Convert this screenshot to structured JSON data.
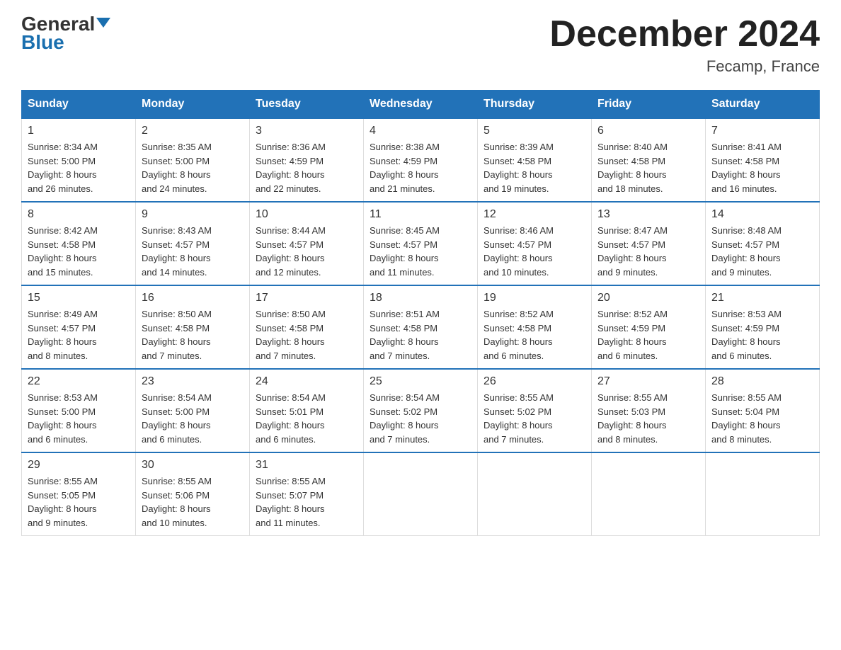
{
  "header": {
    "logo_general": "General",
    "logo_blue": "Blue",
    "month_title": "December 2024",
    "location": "Fecamp, France"
  },
  "days_of_week": [
    "Sunday",
    "Monday",
    "Tuesday",
    "Wednesday",
    "Thursday",
    "Friday",
    "Saturday"
  ],
  "weeks": [
    [
      {
        "day": "1",
        "sunrise": "8:34 AM",
        "sunset": "5:00 PM",
        "daylight": "8 hours and 26 minutes."
      },
      {
        "day": "2",
        "sunrise": "8:35 AM",
        "sunset": "5:00 PM",
        "daylight": "8 hours and 24 minutes."
      },
      {
        "day": "3",
        "sunrise": "8:36 AM",
        "sunset": "4:59 PM",
        "daylight": "8 hours and 22 minutes."
      },
      {
        "day": "4",
        "sunrise": "8:38 AM",
        "sunset": "4:59 PM",
        "daylight": "8 hours and 21 minutes."
      },
      {
        "day": "5",
        "sunrise": "8:39 AM",
        "sunset": "4:58 PM",
        "daylight": "8 hours and 19 minutes."
      },
      {
        "day": "6",
        "sunrise": "8:40 AM",
        "sunset": "4:58 PM",
        "daylight": "8 hours and 18 minutes."
      },
      {
        "day": "7",
        "sunrise": "8:41 AM",
        "sunset": "4:58 PM",
        "daylight": "8 hours and 16 minutes."
      }
    ],
    [
      {
        "day": "8",
        "sunrise": "8:42 AM",
        "sunset": "4:58 PM",
        "daylight": "8 hours and 15 minutes."
      },
      {
        "day": "9",
        "sunrise": "8:43 AM",
        "sunset": "4:57 PM",
        "daylight": "8 hours and 14 minutes."
      },
      {
        "day": "10",
        "sunrise": "8:44 AM",
        "sunset": "4:57 PM",
        "daylight": "8 hours and 12 minutes."
      },
      {
        "day": "11",
        "sunrise": "8:45 AM",
        "sunset": "4:57 PM",
        "daylight": "8 hours and 11 minutes."
      },
      {
        "day": "12",
        "sunrise": "8:46 AM",
        "sunset": "4:57 PM",
        "daylight": "8 hours and 10 minutes."
      },
      {
        "day": "13",
        "sunrise": "8:47 AM",
        "sunset": "4:57 PM",
        "daylight": "8 hours and 9 minutes."
      },
      {
        "day": "14",
        "sunrise": "8:48 AM",
        "sunset": "4:57 PM",
        "daylight": "8 hours and 9 minutes."
      }
    ],
    [
      {
        "day": "15",
        "sunrise": "8:49 AM",
        "sunset": "4:57 PM",
        "daylight": "8 hours and 8 minutes."
      },
      {
        "day": "16",
        "sunrise": "8:50 AM",
        "sunset": "4:58 PM",
        "daylight": "8 hours and 7 minutes."
      },
      {
        "day": "17",
        "sunrise": "8:50 AM",
        "sunset": "4:58 PM",
        "daylight": "8 hours and 7 minutes."
      },
      {
        "day": "18",
        "sunrise": "8:51 AM",
        "sunset": "4:58 PM",
        "daylight": "8 hours and 7 minutes."
      },
      {
        "day": "19",
        "sunrise": "8:52 AM",
        "sunset": "4:58 PM",
        "daylight": "8 hours and 6 minutes."
      },
      {
        "day": "20",
        "sunrise": "8:52 AM",
        "sunset": "4:59 PM",
        "daylight": "8 hours and 6 minutes."
      },
      {
        "day": "21",
        "sunrise": "8:53 AM",
        "sunset": "4:59 PM",
        "daylight": "8 hours and 6 minutes."
      }
    ],
    [
      {
        "day": "22",
        "sunrise": "8:53 AM",
        "sunset": "5:00 PM",
        "daylight": "8 hours and 6 minutes."
      },
      {
        "day": "23",
        "sunrise": "8:54 AM",
        "sunset": "5:00 PM",
        "daylight": "8 hours and 6 minutes."
      },
      {
        "day": "24",
        "sunrise": "8:54 AM",
        "sunset": "5:01 PM",
        "daylight": "8 hours and 6 minutes."
      },
      {
        "day": "25",
        "sunrise": "8:54 AM",
        "sunset": "5:02 PM",
        "daylight": "8 hours and 7 minutes."
      },
      {
        "day": "26",
        "sunrise": "8:55 AM",
        "sunset": "5:02 PM",
        "daylight": "8 hours and 7 minutes."
      },
      {
        "day": "27",
        "sunrise": "8:55 AM",
        "sunset": "5:03 PM",
        "daylight": "8 hours and 8 minutes."
      },
      {
        "day": "28",
        "sunrise": "8:55 AM",
        "sunset": "5:04 PM",
        "daylight": "8 hours and 8 minutes."
      }
    ],
    [
      {
        "day": "29",
        "sunrise": "8:55 AM",
        "sunset": "5:05 PM",
        "daylight": "8 hours and 9 minutes."
      },
      {
        "day": "30",
        "sunrise": "8:55 AM",
        "sunset": "5:06 PM",
        "daylight": "8 hours and 10 minutes."
      },
      {
        "day": "31",
        "sunrise": "8:55 AM",
        "sunset": "5:07 PM",
        "daylight": "8 hours and 11 minutes."
      },
      null,
      null,
      null,
      null
    ]
  ],
  "labels": {
    "sunrise": "Sunrise:",
    "sunset": "Sunset:",
    "daylight": "Daylight:"
  }
}
